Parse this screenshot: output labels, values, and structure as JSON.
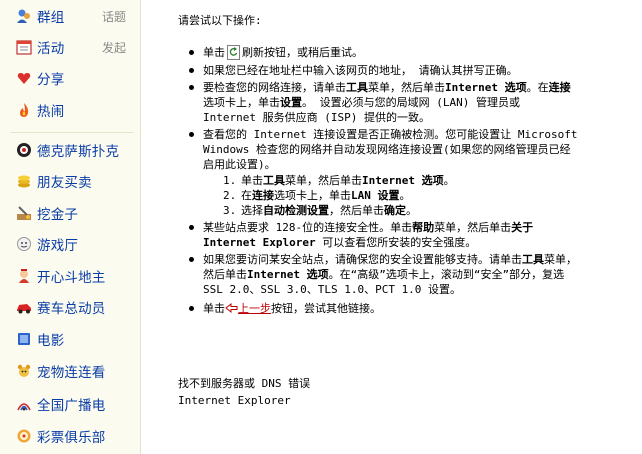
{
  "sidebar": {
    "items": [
      {
        "label": "群组",
        "sub": "话题",
        "icon": "group-icon"
      },
      {
        "label": "活动",
        "sub": "发起",
        "icon": "calendar-icon"
      },
      {
        "label": "分享",
        "icon": "share-icon"
      },
      {
        "label": "热闹",
        "icon": "fire-icon"
      },
      {
        "label": "德克萨斯扑克",
        "icon": "poker-icon"
      },
      {
        "label": "朋友买卖",
        "icon": "coins-icon"
      },
      {
        "label": "挖金子",
        "icon": "dig-icon"
      },
      {
        "label": "游戏厅",
        "icon": "game-icon"
      },
      {
        "label": "开心斗地主",
        "icon": "cards-icon"
      },
      {
        "label": "赛车总动员",
        "icon": "car-icon"
      },
      {
        "label": "电影",
        "icon": "movie-icon"
      },
      {
        "label": "宠物连连看",
        "icon": "pet-icon"
      },
      {
        "label": "全国广播电",
        "icon": "radio-icon"
      },
      {
        "label": "彩票俱乐部",
        "icon": "lottery-icon"
      }
    ]
  },
  "main": {
    "intro": "请尝试以下操作:",
    "s1_a": "单击",
    "s1_b": "刷新按钮，或稍后重试。",
    "s2": "如果您已经在地址栏中输入该网页的地址， 请确认其拼写正确。",
    "s3_a": "要检查您的网络连接，请单击",
    "s3_b": "工具",
    "s3_c": "菜单，然后单击",
    "s3_d": "Internet 选项",
    "s3_e": "。在",
    "s3_f": "连接",
    "s3_g": "选项卡上，单击",
    "s3_h": "设置",
    "s3_i": "。 设置必须与您的局域网 (LAN) 管理员或 Internet 服务供应商 (ISP) 提供的一致。",
    "s4": "查看您的 Internet 连接设置是否正确被检测。您可能设置让 Microsoft Windows 检查您的网络并自动发现网络连接设置(如果您的网络管理员已经启用此设置)。",
    "s4_1a": "单击",
    "s4_1b": "工具",
    "s4_1c": "菜单，然后单击",
    "s4_1d": "Internet 选项",
    "s4_1e": "。",
    "s4_2a": "在",
    "s4_2b": "连接",
    "s4_2c": "选项卡上，单击",
    "s4_2d": "LAN 设置",
    "s4_2e": "。",
    "s4_3a": "选择",
    "s4_3b": "自动检测设置",
    "s4_3c": "，然后单击",
    "s4_3d": "确定",
    "s4_3e": "。",
    "s5_a": "某些站点要求 128-位的连接安全性。单击",
    "s5_b": "帮助",
    "s5_c": "菜单，然后单击",
    "s5_d": "关于 Internet Explorer",
    "s5_e": " 可以查看您所安装的安全强度。",
    "s6_a": "如果您要访问某安全站点，请确保您的安全设置能够支持。请单击",
    "s6_b": "工具",
    "s6_c": "菜单，然后单击",
    "s6_d": "Internet 选项",
    "s6_e": "。在“高级”选项卡上，滚动到“安全”部分，复选 SSL 2.0、SSL 3.0、TLS 1.0、PCT 1.0 设置。",
    "s7_a": "单击",
    "s7_link": "上一步",
    "s7_b": "按钮，尝试其他链接。",
    "err_title": "找不到服务器或 DNS 错误",
    "err_app": "Internet Explorer"
  },
  "colors": {
    "sidebar_bg": "#fbfbef",
    "nav_link": "#0a3ca8",
    "back_link": "#c00000"
  }
}
